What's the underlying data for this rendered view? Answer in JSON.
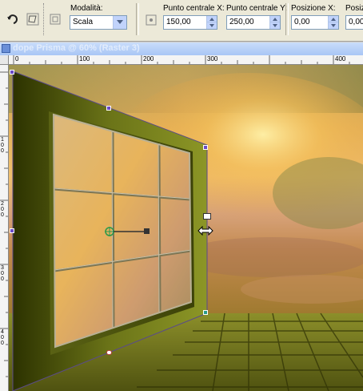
{
  "toolbar": {
    "mode_label": "Modalità:",
    "mode_value": "Scala",
    "center_x_label": "Punto centrale X:",
    "center_x_value": "150,00",
    "center_y_label": "Punto centrale Y:",
    "center_y_value": "250,00",
    "pos_x_label": "Posizione X:",
    "pos_x_value": "0,00",
    "pos_y_label": "Posizio",
    "pos_y_value": "0,00"
  },
  "document": {
    "title": "dope Prisma @ 60% (Raster 3)"
  },
  "ruler": {
    "top_labels": [
      "0",
      "100",
      "200",
      "300",
      "400"
    ],
    "left_labels": [
      "1\n0\n0",
      "2\n0\n0",
      "3\n0\n0",
      "4\n0\n0"
    ]
  },
  "colors": {
    "toolbar_bg": "#ece9d8",
    "frame_green": "#6f7a1a",
    "handle_purple": "#6a4bc8",
    "sky_orange": "#e9a94a"
  }
}
